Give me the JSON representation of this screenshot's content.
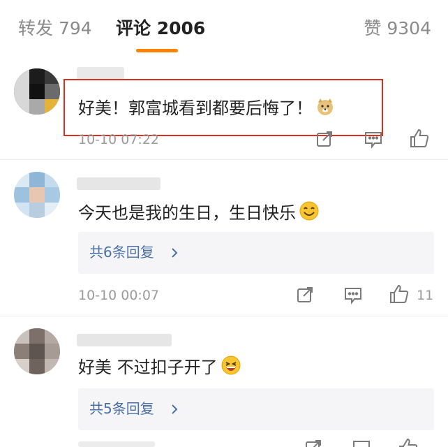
{
  "tabs": {
    "repost": "转发 794",
    "comment_label": "评论",
    "comment_count": "2006",
    "like": "赞 9304"
  },
  "comments": [
    {
      "text": "好美！郭富城看到都要后悔了！",
      "emoji": "doge-emoji",
      "time": "10-10 07:22",
      "like_count": ""
    },
    {
      "text": "今天也是我的生日，生日快乐",
      "emoji": "smile-emoji",
      "reply_label": "共6条回复",
      "time": "10-10 00:07",
      "like_count": "11"
    },
    {
      "text": "好美 不过扣子开了",
      "emoji": "laugh-emoji",
      "reply_label": "共5条回复"
    }
  ],
  "colors": {
    "accent": "#ff8200",
    "link": "#4a6fa5",
    "highlight": "#d9301f"
  }
}
